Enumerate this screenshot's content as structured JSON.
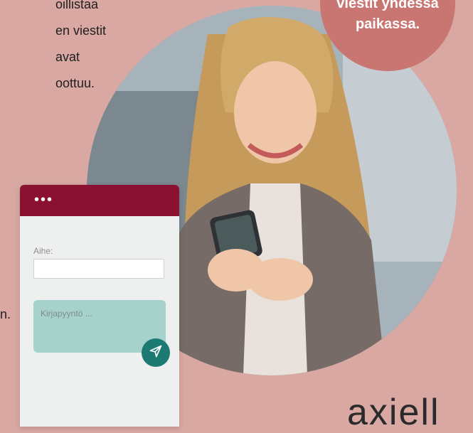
{
  "intro_lines": [
    "oillistaa",
    "en viestit",
    "avat",
    "oottuu."
  ],
  "trail_text": "n.",
  "badge": {
    "line1": "viestit yhdessä",
    "line2": "paikassa."
  },
  "form": {
    "subject_label": "Aihe:",
    "message_placeholder": "Kirjapyyntö ...",
    "header_dots": "•••"
  },
  "logo": "axiell",
  "colors": {
    "background": "#d9a8a3",
    "badge": "#c97572",
    "form_header": "#8b1132",
    "message_area": "#a6d2cc",
    "send_button": "#1c7a72"
  },
  "icons": {
    "send": "send-icon"
  }
}
